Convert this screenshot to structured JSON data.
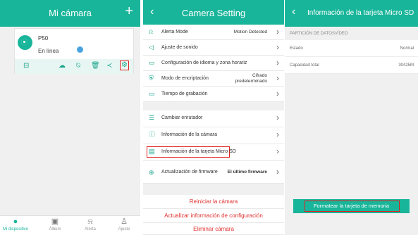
{
  "panel1": {
    "header": {
      "title": "Mi cámara",
      "add_icon": "plus-icon"
    },
    "camera": {
      "name": "P50",
      "status": "En línea",
      "toolbar_icons": [
        "sd-card-icon",
        "cloud-icon",
        "alarm-off-icon",
        "trash-icon",
        "share-icon",
        "gear-icon"
      ]
    },
    "tabs": [
      {
        "label": "Mi dispositivo",
        "icon": "location-pin-icon",
        "active": true
      },
      {
        "label": "Álbum",
        "icon": "image-icon"
      },
      {
        "label": "Alerta",
        "icon": "bell-icon"
      },
      {
        "label": "Ajuste",
        "icon": "person-icon"
      }
    ]
  },
  "panel2": {
    "header": {
      "title": "Camera Setting"
    },
    "group1": [
      {
        "label": "Alerta Mode",
        "value": "Motion Detected",
        "icon": "bell-icon"
      },
      {
        "label": "Ajuste de sonido",
        "value": "",
        "icon": "speaker-icon"
      },
      {
        "label": "Configuración de idioma y zona horariz",
        "value": "",
        "icon": "language-icon"
      },
      {
        "label": "Modo de encriptación",
        "value_line1": "Cifrado",
        "value_line2": "predeterminado",
        "icon": "shield-icon"
      },
      {
        "label": "Tiempo de grabación",
        "value": "",
        "icon": "video-icon"
      }
    ],
    "group2": [
      {
        "label": "Cambiar enrutador",
        "icon": "router-icon"
      },
      {
        "label": "Información de la cámara",
        "icon": "info-icon"
      },
      {
        "label": "Información de la tarjeta Micro SD",
        "icon": "sd-card-icon"
      },
      {
        "label": "Actualización de firmware",
        "value": "El último firmware",
        "icon": "upload-icon"
      }
    ],
    "actions": [
      "Reiniciar la cámara",
      "Actualizar información de configuración",
      "Eliminar cámara"
    ]
  },
  "panel3": {
    "header": {
      "title": "Información de la tarjeta Micro SD"
    },
    "section_label": "PARTICIÓN DE DATOSVÍDEO",
    "rows": [
      {
        "label": "Estado",
        "value": "Normal"
      },
      {
        "label": "Capacidad total",
        "value": "30425M"
      }
    ],
    "format_button": "Formatear la tarjeta de memoria"
  },
  "colors": {
    "accent": "#19b59a",
    "highlight": "#e02020",
    "danger_text": "#e03030"
  }
}
